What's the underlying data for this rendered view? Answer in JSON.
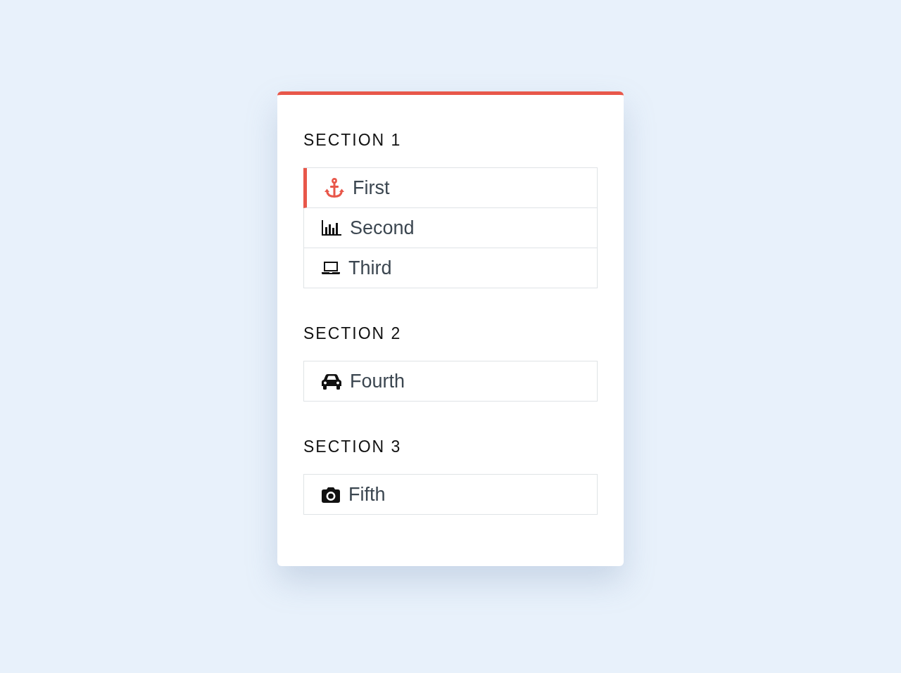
{
  "sections": [
    {
      "title": "SECTION 1",
      "items": [
        {
          "label": "First",
          "selected": true
        },
        {
          "label": "Second",
          "selected": false
        },
        {
          "label": "Third",
          "selected": false
        }
      ]
    },
    {
      "title": "SECTION 2",
      "items": [
        {
          "label": "Fourth",
          "selected": false
        }
      ]
    },
    {
      "title": "SECTION 3",
      "items": [
        {
          "label": "Fifth",
          "selected": false
        }
      ]
    }
  ]
}
